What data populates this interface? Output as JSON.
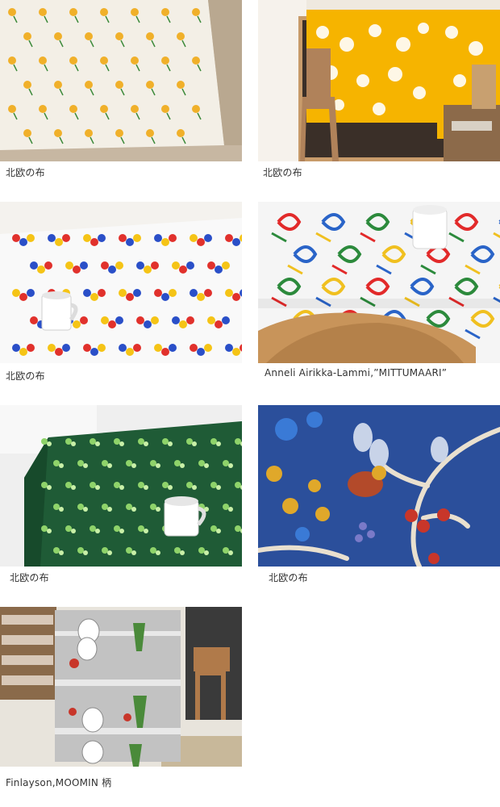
{
  "captions": {
    "c1": "北欧の布",
    "c2": "北欧の布",
    "c3": "北欧の布",
    "c4": "Anneli Airikka-Lammi,”MITTUMAARI”",
    "c5": "北欧の布",
    "c6": "北欧の布",
    "c7": "Finlayson,MOOMIN 柄"
  },
  "photos": [
    {
      "id": "yellow-dot-fabric",
      "colors": [
        "#f2ede2",
        "#f0b02a",
        "#3c8a3a"
      ]
    },
    {
      "id": "yellow-curtain-shelf",
      "colors": [
        "#f5b400",
        "#ffffff",
        "#b5793f"
      ]
    },
    {
      "id": "flower-tablecloth",
      "colors": [
        "#f7f7f7",
        "#e1312c",
        "#2a4fc8",
        "#f5c416"
      ]
    },
    {
      "id": "mittumaari-fabric",
      "colors": [
        "#f5f5f5",
        "#e22a2a",
        "#2a64c8",
        "#2c8a3c"
      ]
    },
    {
      "id": "green-tablecloth",
      "colors": [
        "#1e5a35",
        "#8fd36a",
        "#ffffff"
      ]
    },
    {
      "id": "blue-bird-fabric",
      "colors": [
        "#2a4f9a",
        "#e9e0cf",
        "#e0a82a",
        "#c83a2a"
      ]
    },
    {
      "id": "moomin-fabric",
      "colors": [
        "#bfbfbf",
        "#ffffff",
        "#3a8a3a",
        "#c8362a"
      ]
    }
  ]
}
